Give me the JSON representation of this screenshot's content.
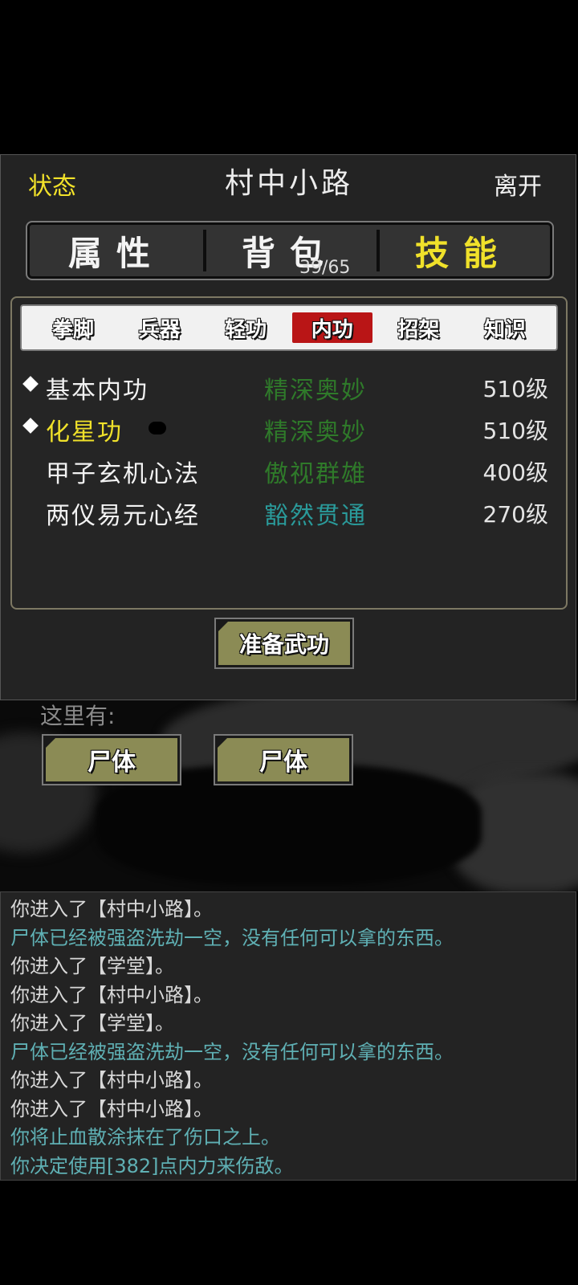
{
  "header": {
    "status_label": "状态",
    "title": "村中小路",
    "leave_label": "离开"
  },
  "main_tabs": [
    {
      "label": "属性",
      "active": false
    },
    {
      "label": "背包",
      "active": false,
      "count": "39/65"
    },
    {
      "label": "技能",
      "active": true
    }
  ],
  "skill_tabs": [
    {
      "label": "拳脚",
      "active": false
    },
    {
      "label": "兵器",
      "active": false
    },
    {
      "label": "轻功",
      "active": false
    },
    {
      "label": "内功",
      "active": true
    },
    {
      "label": "招架",
      "active": false
    },
    {
      "label": "知识",
      "active": false
    }
  ],
  "skills": [
    {
      "name": "基本内功",
      "rank": "精深奥妙",
      "level": "510级",
      "equipped": true
    },
    {
      "name": "化星功",
      "rank": "精深奥妙",
      "level": "510级",
      "equipped": true
    },
    {
      "name": "甲子玄机心法",
      "rank": "傲视群雄",
      "level": "400级",
      "equipped": false
    },
    {
      "name": "两仪易元心经",
      "rank": "豁然贯通",
      "level": "270级",
      "equipped": false
    }
  ],
  "prepare_button": "准备武功",
  "scene": {
    "here_label": "这里有:",
    "objects": [
      "尸体",
      "尸体"
    ]
  },
  "log": [
    {
      "text": "你进入了【村中小路】。",
      "color": "#d8d8d8"
    },
    {
      "text": "尸体已经被强盗洗劫一空，没有任何可以拿的东西。",
      "color": "#5fb0b4"
    },
    {
      "text": "你进入了【学堂】。",
      "color": "#d8d8d8"
    },
    {
      "text": "你进入了【村中小路】。",
      "color": "#d8d8d8"
    },
    {
      "text": "你进入了【学堂】。",
      "color": "#d8d8d8"
    },
    {
      "text": "尸体已经被强盗洗劫一空，没有任何可以拿的东西。",
      "color": "#5fb0b4"
    },
    {
      "text": "你进入了【村中小路】。",
      "color": "#d8d8d8"
    },
    {
      "text": "你进入了【村中小路】。",
      "color": "#d8d8d8"
    },
    {
      "text": "你将止血散涂抹在了伤口之上。",
      "color": "#5fb0b4"
    },
    {
      "text": "你决定使用[382]点内力来伤敌。",
      "color": "#5fb0b4"
    }
  ],
  "colors": {
    "accent_yellow": "#f0e12a",
    "active_tab_red": "#b91516",
    "button_olive": "#8b8b55",
    "rank_green": "#2f7a2a",
    "rank_teal": "#2a9a9a"
  }
}
